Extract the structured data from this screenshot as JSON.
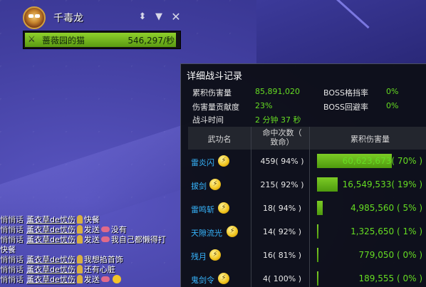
{
  "target": {
    "boss_name": "千毒龙",
    "player_name": "蔷薇园的猫",
    "dps": "546,297/秒",
    "bar_fraction": 0.98
  },
  "panel": {
    "title": "详细战斗记录",
    "stats": {
      "total_damage_label": "累积伤害量",
      "total_damage_value": "85,891,020",
      "boss_block_label": "BOSS格挡率",
      "boss_block_value": "0%",
      "contribution_label": "伤害量贡献度",
      "contribution_value": "23%",
      "boss_evade_label": "BOSS回避率",
      "boss_evade_value": "0%",
      "time_label": "战斗时间",
      "time_value": "2 分钟 37 秒"
    },
    "headers": {
      "skill": "武功名",
      "hits_line1": "命中次数（",
      "hits_line2": "致命）",
      "damage": "累积伤害量"
    },
    "rows": [
      {
        "skill": "雷炎闪",
        "hits": "459( 94% )",
        "damage": "60,623,673( 70% )",
        "share": 0.7
      },
      {
        "skill": "拔剑",
        "hits": "215( 92% )",
        "damage": "16,549,533( 19% )",
        "share": 0.19
      },
      {
        "skill": "雷鸣斩",
        "hits": "18( 94% )",
        "damage": "4,985,560 ( 5% )",
        "share": 0.05
      },
      {
        "skill": "天隙流光",
        "hits": "14( 92% )",
        "damage": "1,325,650 ( 1% )",
        "share": 0.01
      },
      {
        "skill": "残月",
        "hits": "16( 81% )",
        "damage": "779,050 ( 0% )",
        "share": 0.0
      },
      {
        "skill": "鬼剑令",
        "hits": "4( 100% )",
        "damage": "189,555 ( 0% )",
        "share": 0.0
      }
    ]
  },
  "chat": {
    "lines": [
      {
        "tag": "",
        "sender": "",
        "verb": "",
        "msg": ""
      },
      {
        "tag": "悄悄话",
        "sender": "薰衣草de忧伤",
        "verb": "",
        "msg": "快餐"
      },
      {
        "tag": "悄悄话",
        "sender": "薰衣草de忧伤",
        "verb": "发送",
        "msg": "没有"
      },
      {
        "tag": "悄悄话",
        "sender": "薰衣草de忧伤",
        "verb": "发送",
        "msg": "我自己都懒得打"
      },
      {
        "tag": "",
        "sender": "",
        "verb": "",
        "msg": "快餐"
      },
      {
        "tag": "悄悄话",
        "sender": "薰衣草de忧伤",
        "verb": "",
        "msg": "我想掐首饰"
      },
      {
        "tag": "悄悄话",
        "sender": "薰衣草de忧伤",
        "verb": "",
        "msg": "还有心脏"
      },
      {
        "tag": "悄悄话",
        "sender": "薰衣草de忧伤",
        "verb": "发送",
        "msg": ""
      }
    ]
  }
}
